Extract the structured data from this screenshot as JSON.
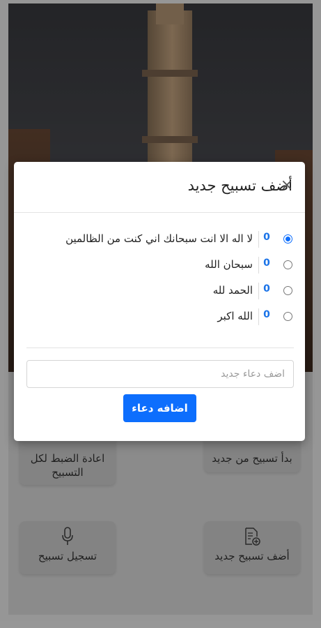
{
  "modal": {
    "title": "أضف تسبيح جديد",
    "close_label": "×",
    "items": [
      {
        "text": "لا اله الا انت سبحانك اني كنت من الظالمين",
        "count": "0",
        "selected": true
      },
      {
        "text": "سبحان الله",
        "count": "0",
        "selected": false
      },
      {
        "text": "الحمد لله",
        "count": "0",
        "selected": false
      },
      {
        "text": "الله اكبر",
        "count": "0",
        "selected": false
      }
    ],
    "input_placeholder": "اضف دعاء جديد",
    "add_button_label": "اضافه دعاء"
  },
  "actions": {
    "reset_all": "اعادة الضبط لكل التسبيح",
    "restart": "بدأ تسبيح من جديد",
    "record": "تسجيل تسبيح",
    "add_new": "أضف تسبيح جديد"
  },
  "icons": [
    "microphone-icon",
    "add-file-icon"
  ],
  "colors": {
    "accent": "#0d6efd",
    "count": "#1a73e8",
    "overlay": "rgba(0,0,0,0.38)"
  }
}
